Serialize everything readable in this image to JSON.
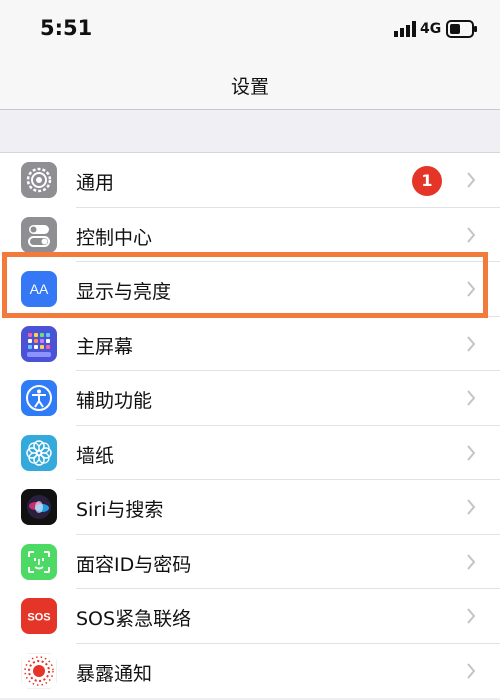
{
  "status_bar": {
    "time": "5:51",
    "network": "4G"
  },
  "nav": {
    "title": "设置"
  },
  "settings": [
    {
      "label": "通用",
      "icon": "gear-icon",
      "badge": "1"
    },
    {
      "label": "控制中心",
      "icon": "toggles-icon"
    },
    {
      "label": "显示与亮度",
      "icon": "text-size-icon"
    },
    {
      "label": "主屏幕",
      "icon": "home-grid-icon"
    },
    {
      "label": "辅助功能",
      "icon": "accessibility-icon"
    },
    {
      "label": "墙纸",
      "icon": "flower-icon"
    },
    {
      "label": "Siri与搜索",
      "icon": "siri-icon"
    },
    {
      "label": "面容ID与密码",
      "icon": "face-id-icon"
    },
    {
      "label": "SOS紧急联络",
      "icon": "sos-icon"
    },
    {
      "label": "暴露通知",
      "icon": "exposure-icon"
    }
  ],
  "icon_labels": {
    "display": "AA",
    "sos": "SOS"
  },
  "colors": {
    "highlight": "#f27a3a",
    "badge": "#e53529",
    "display_icon_bg": "#3478f6",
    "accessibility_icon_bg": "#2f7cf6",
    "wallpaper_icon_bg": "#34aadc",
    "face_id_icon_bg": "#4cd964",
    "sos_icon_bg": "#e53529",
    "general_icon_bg": "#8e8e93"
  }
}
